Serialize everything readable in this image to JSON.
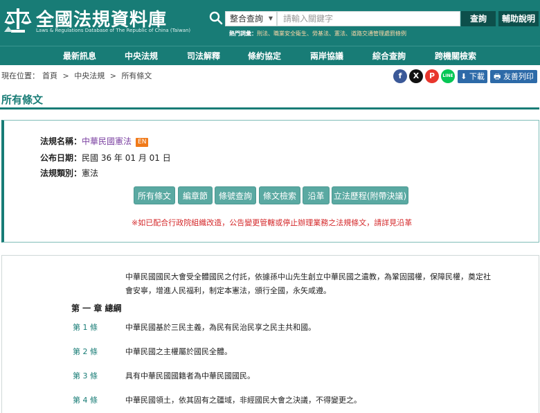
{
  "header": {
    "title": "全國法規資料庫",
    "subtitle": "Laws & Regulations Database of The Republic of China (Taiwan)",
    "search_select": "整合查詢",
    "search_placeholder": "請輸入關鍵字",
    "search_button": "查詢",
    "help_button": "輔助說明",
    "hot_label": "熱門詞彙：",
    "hot_words": "刑法、職業安全衛生、勞基法、憲法、道路交通管理處罰條例"
  },
  "nav": [
    "最新訊息",
    "中央法規",
    "司法解釋",
    "條約協定",
    "兩岸協議",
    "綜合查詢",
    "跨機關檢索"
  ],
  "breadcrumb": {
    "prefix": "現在位置：",
    "items": [
      "首頁",
      "中央法規",
      "所有條文"
    ],
    "separator": ">"
  },
  "social": {
    "facebook": "f",
    "x": "X",
    "plurk": "P",
    "line": "LINE"
  },
  "tools": {
    "download": "下載",
    "print": "友善列印"
  },
  "section_title": "所有條文",
  "law_info": {
    "name_label": "法規名稱：",
    "name": "中華民國憲法",
    "en_badge": "EN",
    "date_label": "公布日期：",
    "date": "民國 36 年 01 月 01 日",
    "category_label": "法規類別：",
    "category": "憲法"
  },
  "action_buttons": [
    "所有條文",
    "編章節",
    "條號查詢",
    "條文檢索",
    "沿革",
    "立法歷程(附帶決議)"
  ],
  "notice": "※如已配合行政院組織改造，公告變更管轄或停止辦理業務之法規條文，請詳見沿革",
  "content": {
    "preamble_line1": "中華民國國民大會受全體國民之付託，依據孫中山先生創立中華民國之遺教，為鞏固國權，保障民權，奠定社",
    "preamble_line2": "會安寧，增進人民福利，制定本憲法，頒行全國，永矢咸遵。",
    "chapter": "第 一 章 總綱",
    "articles": [
      {
        "no": "第 1 條",
        "text": "中華民國基於三民主義，為民有民治民享之民主共和國。"
      },
      {
        "no": "第 2 條",
        "text": "中華民國之主權屬於國民全體。"
      },
      {
        "no": "第 3 條",
        "text": "具有中華民國國籍者為中華民國國民。"
      },
      {
        "no": "第 4 條",
        "text": "中華民國領土，依其固有之疆域，非經國民大會之決議，不得變更之。"
      }
    ]
  },
  "colors": {
    "brand": "#187c76",
    "brand_dark": "#0d4f4b",
    "button": "#5aa9a2",
    "notice": "#d4282a",
    "tool_button": "#2d6aa8"
  }
}
